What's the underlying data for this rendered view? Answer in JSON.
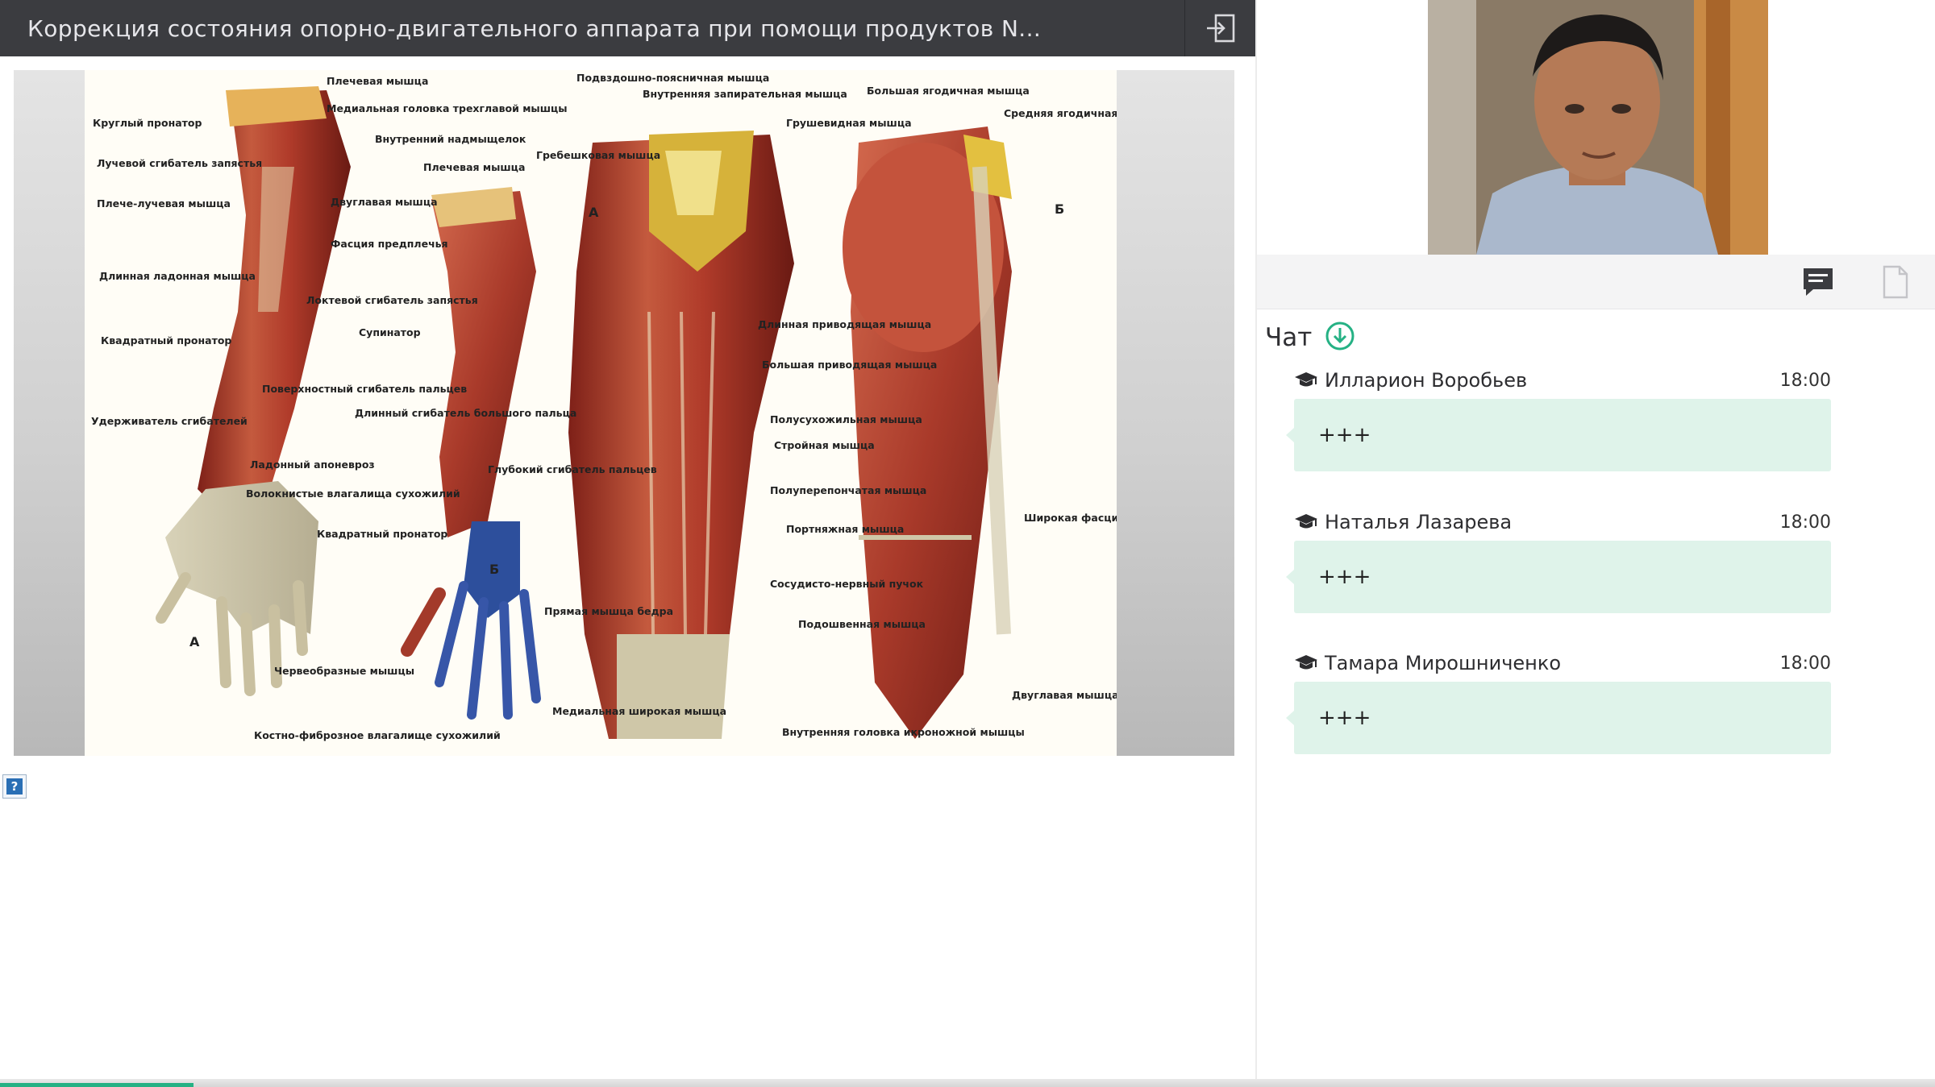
{
  "header": {
    "title": "Коррекция состояния опорно-двигательного аппарата при помощи продуктов N...",
    "exit_icon": "exit-icon"
  },
  "slide": {
    "labels": {
      "arm_a": [
        "Плечевая мышца",
        "Медиальная головка трехглавой мышцы",
        "Внутренний надмыщелок",
        "Круглый пронатор",
        "Лучевой сгибатель запястья",
        "Плече-лучевая мышца",
        "Двуглавая мышца",
        "Фасция предплечья",
        "Длинная ладонная мышца",
        "Локтевой сгибатель запястья",
        "Квадратный пронатор",
        "Поверхностный сгибатель пальцев",
        "Удерживатель сгибателей",
        "Ладонный апоневроз",
        "Волокнистые влагалища сухожилий",
        "А"
      ],
      "arm_b": [
        "Плечевая мышца",
        "Супинатор",
        "Длинный сгибатель большого пальца",
        "Глубокий сгибатель пальцев",
        "Квадратный пронатор",
        "Червеобразные мышцы",
        "Костно-фиброзное влагалище сухожилий",
        "Б"
      ],
      "leg_a": [
        "Подвздошно-поясничная мышца",
        "Внутренняя запирательная мышца",
        "Грушевидная мышца",
        "Гребешковая мышца",
        "Длинная приводящая мышца",
        "Большая приводящая мышца",
        "Полусухожильная мышца",
        "Стройная мышца",
        "Полуперепончатая мышца",
        "Портняжная мышца",
        "Сосудисто-нервный пучок",
        "Подошвенная мышца",
        "Прямая мышца бедра",
        "Медиальная широкая мышца",
        "Внутренняя головка икроножной мышцы",
        "А"
      ],
      "leg_b": [
        "Большая ягодичная мышца",
        "Средняя ягодичная мышца (покрыта фасцией)",
        "Широкая фасция",
        "Двуглавая мышца бедра",
        "Б"
      ]
    }
  },
  "help": {
    "label": "?"
  },
  "toolbar": {
    "chat_icon": "chat-bubble-icon",
    "doc_icon": "document-icon"
  },
  "chat": {
    "title": "Чат",
    "download_icon": "download-circle-icon",
    "messages": [
      {
        "author": "Илларион Воробьев",
        "time": "18:00",
        "text": "+++"
      },
      {
        "author": "Наталья Лазарева",
        "time": "18:00",
        "text": "+++"
      },
      {
        "author": "Тамара Мирошниченко",
        "time": "18:00",
        "text": "+++"
      }
    ]
  },
  "progress": {
    "fraction": 0.1
  },
  "colors": {
    "accent": "#25b184",
    "topbar": "#3b3c40",
    "bubble": "#dff3ea"
  }
}
